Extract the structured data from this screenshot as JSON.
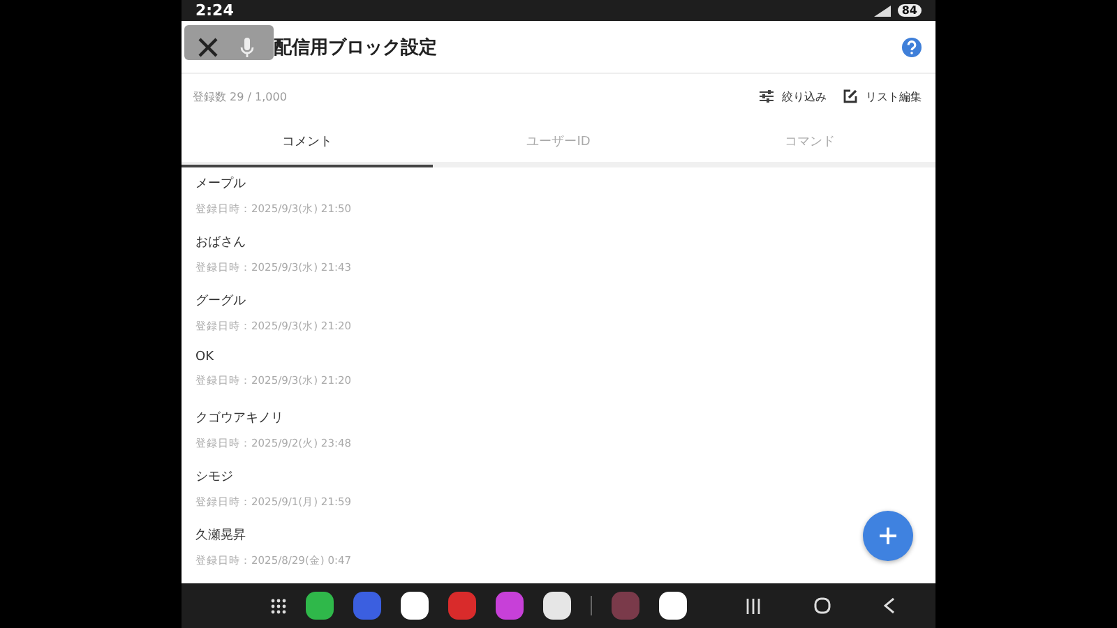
{
  "status_bar": {
    "time": "2:24",
    "battery": "84"
  },
  "header": {
    "title": "配信用ブロック設定"
  },
  "info": {
    "count": "登録数 29 / 1,000",
    "filter": "絞り込み",
    "edit": "リスト編集"
  },
  "tabs": [
    {
      "label": "コメント",
      "selected": true
    },
    {
      "label": "ユーザーID",
      "selected": false
    },
    {
      "label": "コマンド",
      "selected": false
    }
  ],
  "items": [
    {
      "name": "メープル",
      "date": "登録日時：2025/9/3(水) 21:50"
    },
    {
      "name": "おばさん",
      "date": "登録日時：2025/9/3(水) 21:43"
    },
    {
      "name": "グーグル",
      "date": "登録日時：2025/9/3(水) 21:20"
    },
    {
      "name": "OK",
      "date": "登録日時：2025/9/3(水) 21:20"
    },
    {
      "name": "クゴウアキノリ",
      "date": "登録日時：2025/9/2(火) 23:48"
    },
    {
      "name": "シモジ",
      "date": "登録日時：2025/9/1(月) 21:59"
    },
    {
      "name": "久瀬晃昇",
      "date": "登録日時：2025/8/29(金) 0:47"
    }
  ],
  "dock": [
    {
      "color": "#2fb84a"
    },
    {
      "color": "#3b5fe0"
    },
    {
      "color": "#ffffff"
    },
    {
      "color": "#d92b2b"
    },
    {
      "color": "#c740d8"
    },
    {
      "color": "#e6e6e6"
    },
    {
      "color": "#7a3a4a"
    },
    {
      "color": "#ffffff"
    }
  ]
}
